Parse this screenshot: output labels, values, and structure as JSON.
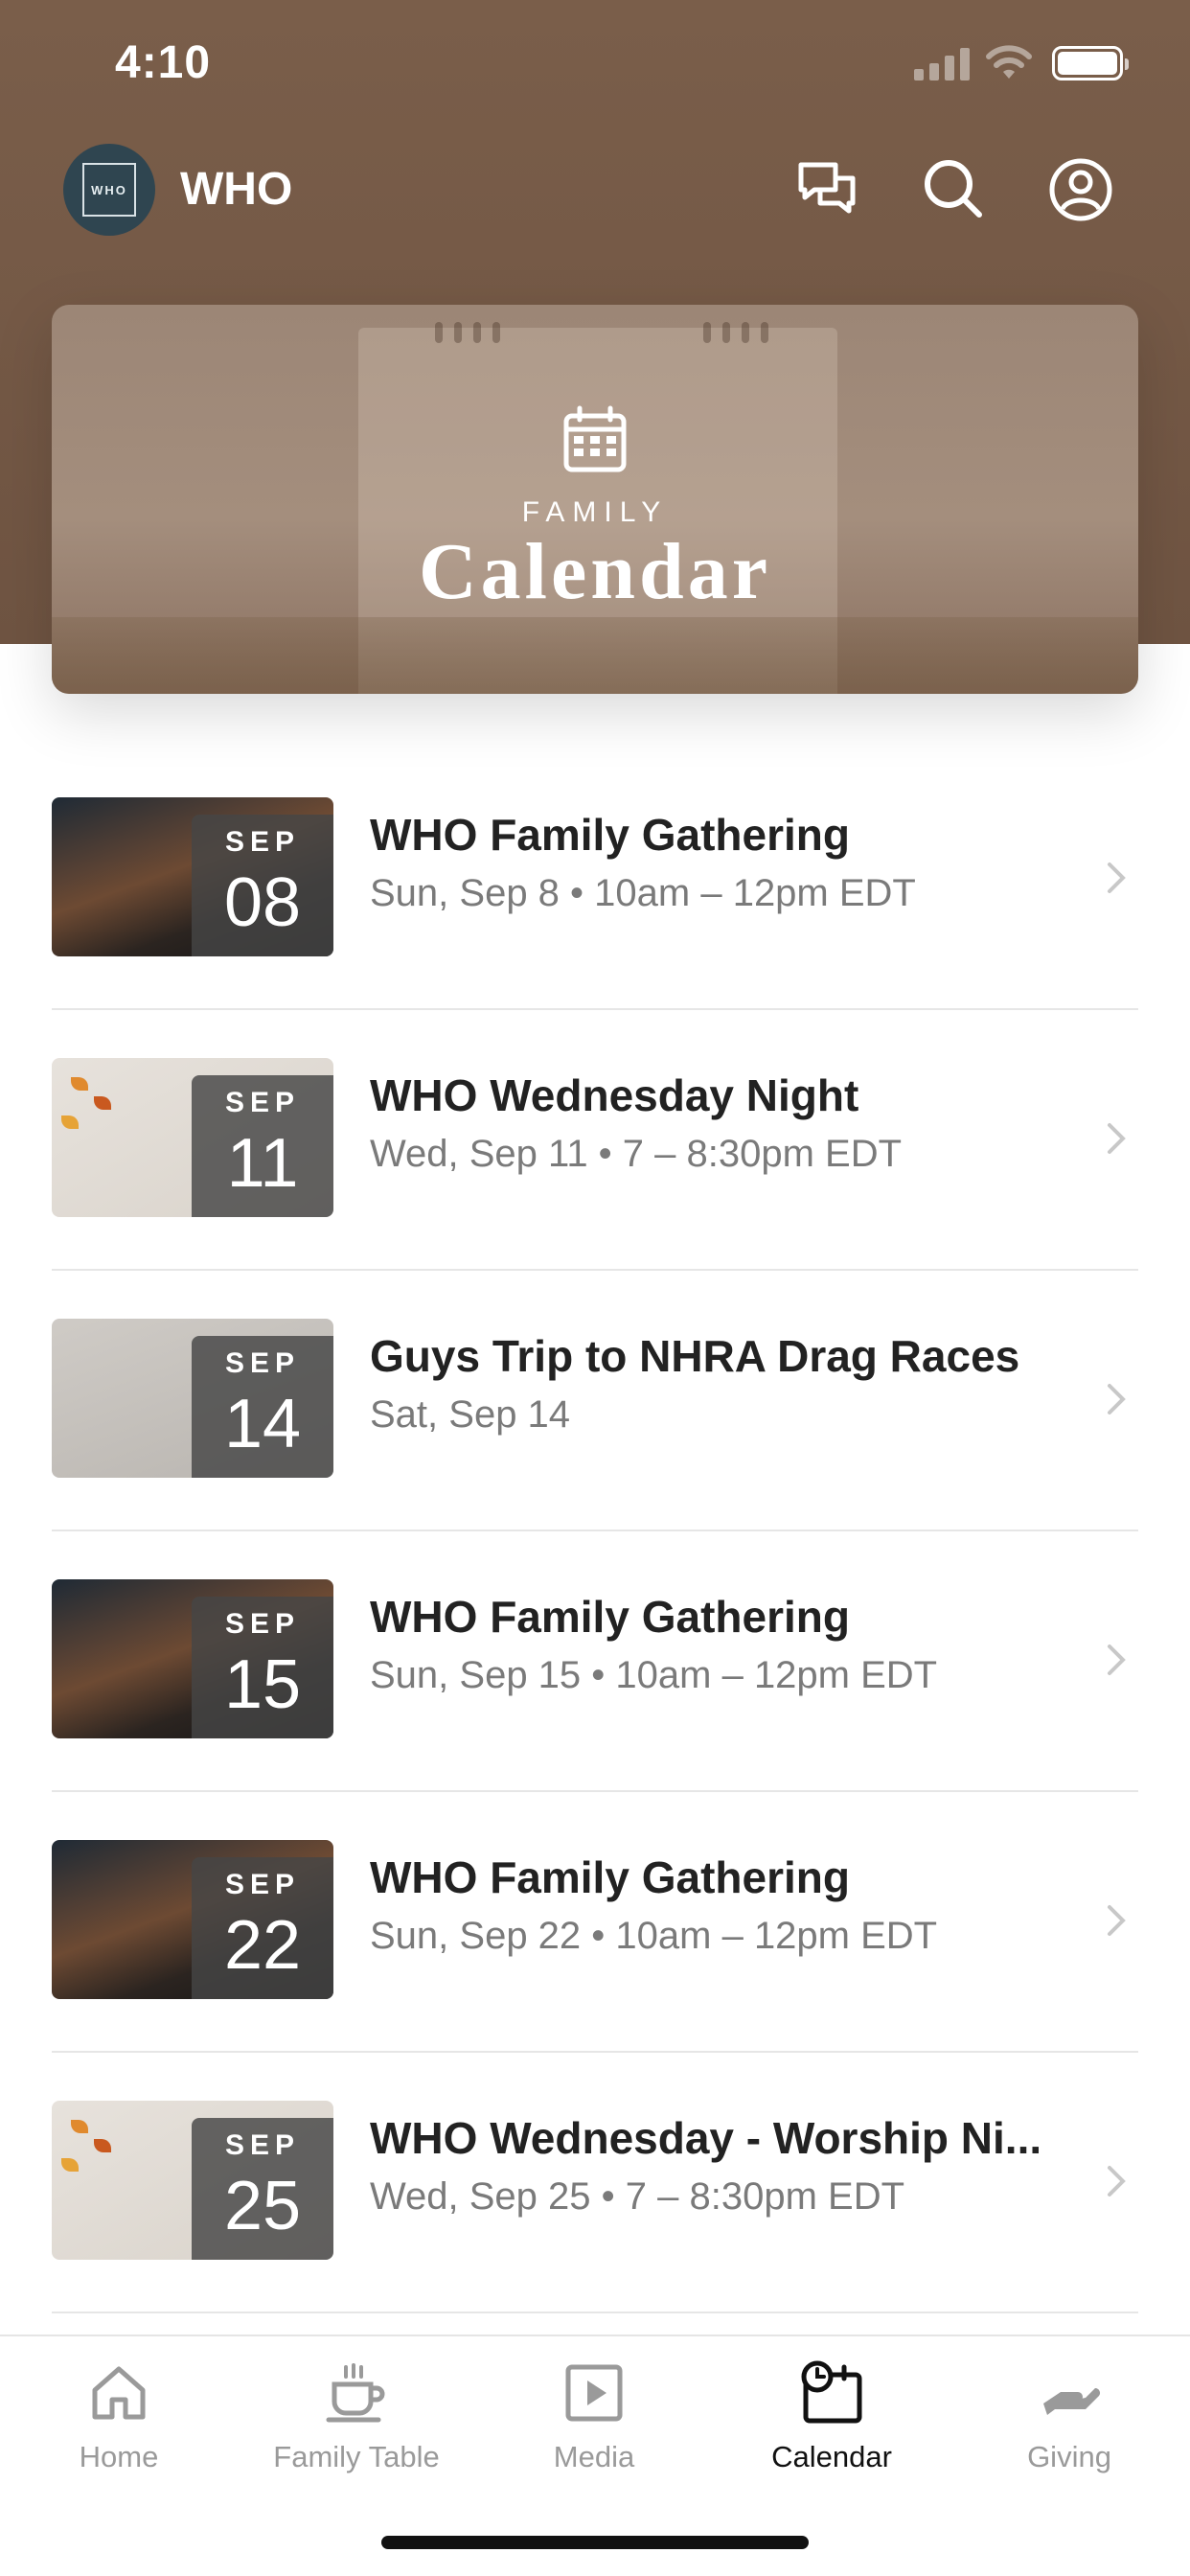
{
  "status_bar": {
    "time": "4:10"
  },
  "header": {
    "logo_text": "WHO",
    "app_name": "WHO",
    "icons": [
      "chat-icon",
      "search-icon",
      "profile-icon"
    ]
  },
  "hero": {
    "kicker": "FAMILY",
    "title": "Calendar",
    "icon": "calendar-grid-icon"
  },
  "events": [
    {
      "month": "SEP",
      "day": "08",
      "title": "WHO Family Gathering",
      "subtitle": "Sun, Sep 8 • 10am – 12pm EDT",
      "thumb": "sunday"
    },
    {
      "month": "SEP",
      "day": "11",
      "title": "WHO Wednesday Night",
      "subtitle": "Wed, Sep 11 • 7 – 8:30pm EDT",
      "thumb": "wednesday"
    },
    {
      "month": "SEP",
      "day": "14",
      "title": "Guys Trip to NHRA Drag Races",
      "subtitle": "Sat, Sep 14",
      "thumb": "drag"
    },
    {
      "month": "SEP",
      "day": "15",
      "title": "WHO Family Gathering",
      "subtitle": "Sun, Sep 15 • 10am – 12pm EDT",
      "thumb": "sunday"
    },
    {
      "month": "SEP",
      "day": "22",
      "title": "WHO Family Gathering",
      "subtitle": "Sun, Sep 22 • 10am – 12pm EDT",
      "thumb": "sunday"
    },
    {
      "month": "SEP",
      "day": "25",
      "title": "WHO Wednesday - Worship Ni...",
      "subtitle": "Wed, Sep 25 • 7 – 8:30pm EDT",
      "thumb": "wednesday"
    }
  ],
  "tabs": [
    {
      "label": "Home",
      "icon": "home-icon",
      "active": false
    },
    {
      "label": "Family Table",
      "icon": "coffee-cup-icon",
      "active": false
    },
    {
      "label": "Media",
      "icon": "play-icon",
      "active": false
    },
    {
      "label": "Calendar",
      "icon": "calendar-clock-icon",
      "active": true
    },
    {
      "label": "Giving",
      "icon": "giving-hand-icon",
      "active": false
    }
  ],
  "colors": {
    "header_brown": "#7a5e4a",
    "active_tab": "#111111",
    "inactive_tab": "#9a9a9a"
  }
}
